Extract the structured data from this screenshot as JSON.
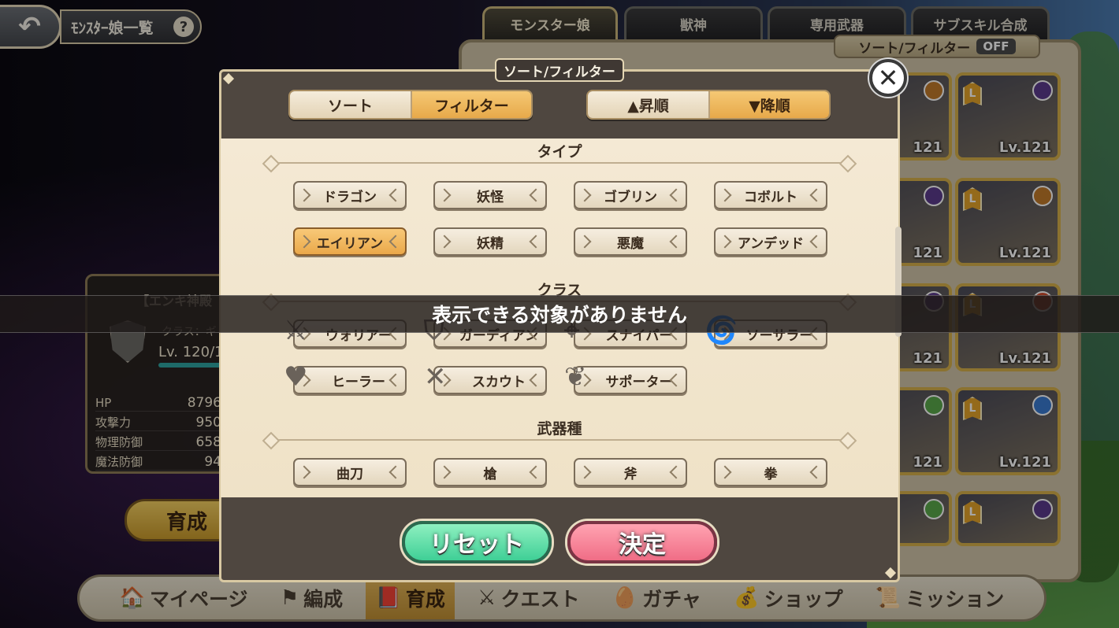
{
  "header": {
    "back_icon": "back-arrow-icon",
    "title": "ﾓﾝｽﾀｰ娘一覧",
    "help_label": "?"
  },
  "top_tabs": [
    {
      "label": "モンスター娘",
      "active": true
    },
    {
      "label": "獣神",
      "active": false
    },
    {
      "label": "専用武器",
      "active": false
    },
    {
      "label": "サブスキル合成",
      "active": false
    }
  ],
  "sort_filter_indicator": {
    "label": "ソート/フィルター",
    "state": "OFF"
  },
  "character_grid": {
    "cards": [
      {
        "level": "121",
        "element_color": "#c07a2a"
      },
      {
        "level": "Lv.121",
        "element_color": "#5b3b8c"
      },
      {
        "level": "121",
        "element_color": "#5b3b8c"
      },
      {
        "level": "Lv.121",
        "element_color": "#c07a2a"
      },
      {
        "level": "121",
        "element_color": "#5b3b8c"
      },
      {
        "level": "Lv.121",
        "element_color": "#d04a2a"
      },
      {
        "level": "121",
        "element_color": "#5aa84a"
      },
      {
        "level": "Lv.121",
        "element_color": "#3a7ad0"
      },
      {
        "level": "",
        "element_color": "#5aa84a"
      },
      {
        "level": "",
        "element_color": "#5b3b8c"
      }
    ]
  },
  "info_panel": {
    "name": "【エンキ神殿",
    "class_label": "クラス：ギ",
    "level": "Lv. 120/1",
    "stats": [
      {
        "label": "HP",
        "value": "8796"
      },
      {
        "label": "攻撃力",
        "value": "950"
      },
      {
        "label": "物理防御",
        "value": "658"
      },
      {
        "label": "魔法防御",
        "value": "94"
      }
    ],
    "develop_button": "育成"
  },
  "modal": {
    "title": "ソート/フィルター",
    "close_label": "✕",
    "mode_tabs": [
      {
        "label": "ソート",
        "on": false
      },
      {
        "label": "フィルター",
        "on": true
      }
    ],
    "order_tabs": [
      {
        "label": "▲昇順",
        "on": false
      },
      {
        "label": "▼降順",
        "on": true
      }
    ],
    "sections": {
      "type": {
        "title": "タイプ",
        "items": [
          {
            "label": "ドラゴン",
            "on": false
          },
          {
            "label": "妖怪",
            "on": false
          },
          {
            "label": "ゴブリン",
            "on": false
          },
          {
            "label": "コボルト",
            "on": false
          },
          {
            "label": "エイリアン",
            "on": true
          },
          {
            "label": "妖精",
            "on": false
          },
          {
            "label": "悪魔",
            "on": false
          },
          {
            "label": "アンデッド",
            "on": false
          }
        ]
      },
      "class": {
        "title": "クラス",
        "items": [
          {
            "label": "ウォリアー",
            "icon": "crossed-swords-icon",
            "glyph": "⚔"
          },
          {
            "label": "ガーディアン",
            "icon": "shield-icon",
            "glyph": "⛉"
          },
          {
            "label": "スナイパー",
            "icon": "crosshair-icon",
            "glyph": "⌖"
          },
          {
            "label": "ソーサラー",
            "icon": "swirl-icon",
            "glyph": "🌀"
          },
          {
            "label": "ヒーラー",
            "icon": "heart-icon",
            "glyph": "♥"
          },
          {
            "label": "スカウト",
            "icon": "daggers-icon",
            "glyph": "✕"
          },
          {
            "label": "サポーター",
            "icon": "wing-icon",
            "glyph": "❦"
          }
        ]
      },
      "weapon": {
        "title": "武器種",
        "items": [
          {
            "label": "曲刀",
            "on": false
          },
          {
            "label": "槍",
            "on": false
          },
          {
            "label": "斧",
            "on": false
          },
          {
            "label": "拳",
            "on": false
          }
        ]
      }
    },
    "reset_label": "リセット",
    "confirm_label": "決定"
  },
  "toast": {
    "message": "表示できる対象がありません"
  },
  "bottom_nav": [
    {
      "label": "マイページ",
      "icon": "mushroom-house-icon",
      "glyph": "🏠",
      "active": false
    },
    {
      "label": "編成",
      "icon": "flag-icon",
      "glyph": "⚑",
      "active": false
    },
    {
      "label": "育成",
      "icon": "book-icon",
      "glyph": "📕",
      "active": true
    },
    {
      "label": "クエスト",
      "icon": "crossed-swords-icon",
      "glyph": "⚔",
      "active": false
    },
    {
      "label": "ガチャ",
      "icon": "egg-icon",
      "glyph": "🥚",
      "active": false
    },
    {
      "label": "ショップ",
      "icon": "money-bag-icon",
      "glyph": "💰",
      "active": false
    },
    {
      "label": "ミッション",
      "icon": "scroll-icon",
      "glyph": "📜",
      "active": false
    }
  ]
}
